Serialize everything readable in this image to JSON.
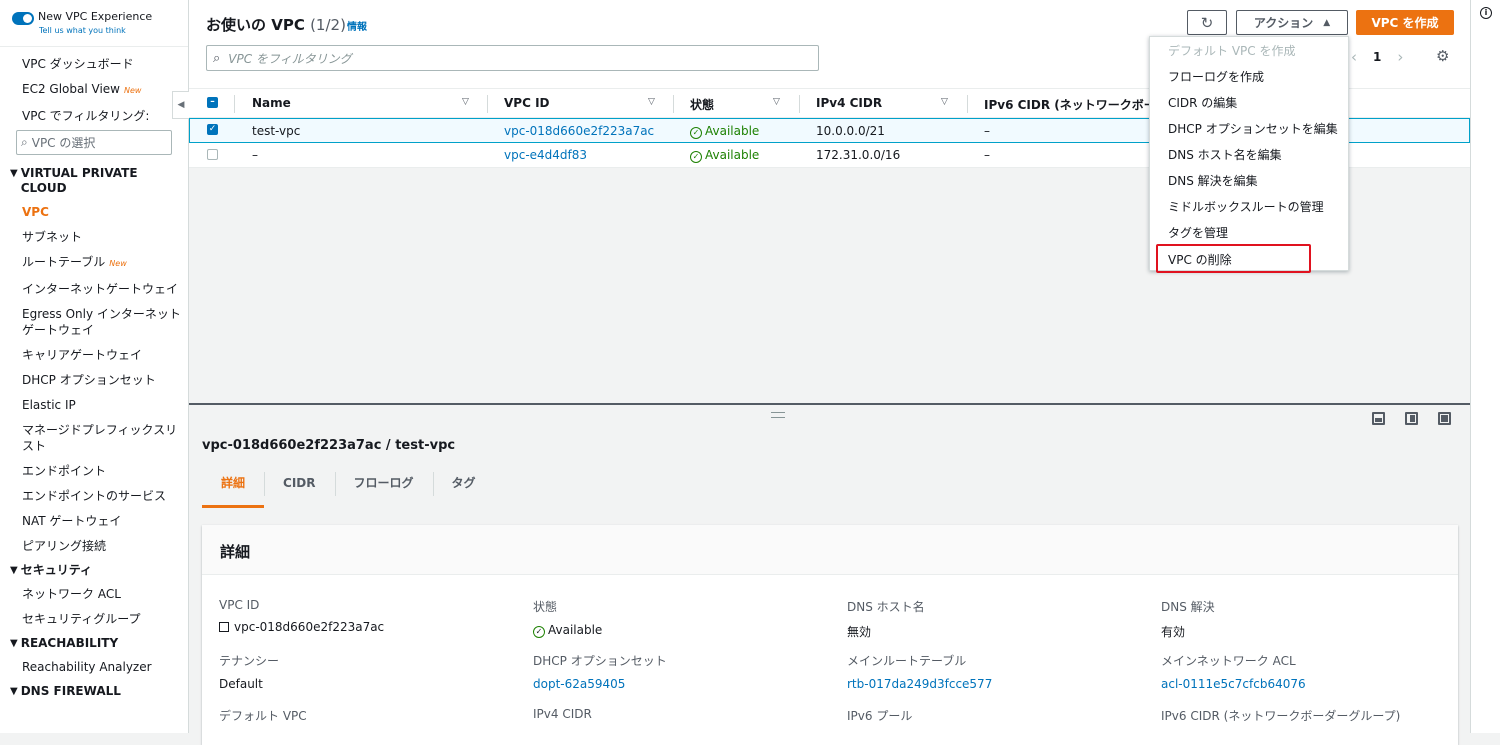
{
  "sidebar": {
    "experience_toggle": "New VPC Experience",
    "experience_sub": "Tell us what you think",
    "dashboard": "VPC ダッシュボード",
    "global_view": "EC2 Global View",
    "new_badge": "New",
    "filter_label": "VPC でフィルタリング:",
    "filter_placeholder": "VPC の選択",
    "section_vpc": "VIRTUAL PRIVATE CLOUD",
    "vpc": "VPC",
    "subnets": "サブネット",
    "route_tables": "ルートテーブル",
    "igw": "インターネットゲートウェイ",
    "egress_igw": "Egress Only インターネットゲートウェイ",
    "carrier_gw": "キャリアゲートウェイ",
    "dhcp": "DHCP オプションセット",
    "elastic_ip": "Elastic IP",
    "prefix_list": "マネージドプレフィックスリスト",
    "endpoints": "エンドポイント",
    "endpoint_services": "エンドポイントのサービス",
    "nat_gw": "NAT ゲートウェイ",
    "peering": "ピアリング接続",
    "section_security": "セキュリティ",
    "nacl": "ネットワーク ACL",
    "security_groups": "セキュリティグループ",
    "section_reachability": "REACHABILITY",
    "reachability_analyzer": "Reachability Analyzer",
    "section_dns": "DNS FIREWALL"
  },
  "header": {
    "title": "お使いの VPC",
    "count": "(1/2)",
    "info": "情報",
    "actions": "アクション",
    "create": "VPC を作成",
    "search_placeholder": "VPC をフィルタリング",
    "page": "1"
  },
  "table": {
    "headers": [
      "Name",
      "VPC ID",
      "状態",
      "IPv4 CIDR",
      "IPv6 CIDR (ネットワークボーダ"
    ],
    "rows": [
      {
        "name": "test-vpc",
        "id": "vpc-018d660e2f223a7ac",
        "state": "Available",
        "ipv4": "10.0.0.0/21",
        "ipv6": "–"
      },
      {
        "name": "–",
        "id": "vpc-e4d4df83",
        "state": "Available",
        "ipv4": "172.31.0.0/16",
        "ipv6": "–"
      }
    ]
  },
  "dropdown": {
    "items": [
      "デフォルト VPC を作成",
      "フローログを作成",
      "CIDR の編集",
      "DHCP オプションセットを編集",
      "DNS ホスト名を編集",
      "DNS 解決を編集",
      "ミドルボックスルートの管理",
      "タグを管理",
      "VPC の削除"
    ]
  },
  "details": {
    "title": "vpc-018d660e2f223a7ac / test-vpc",
    "tabs": [
      "詳細",
      "CIDR",
      "フローログ",
      "タグ"
    ],
    "card_title": "詳細",
    "vpc_id_label": "VPC ID",
    "vpc_id": "vpc-018d660e2f223a7ac",
    "state_label": "状態",
    "state": "Available",
    "dns_host_label": "DNS ホスト名",
    "dns_host": "無効",
    "dns_res_label": "DNS 解決",
    "dns_res": "有効",
    "tenancy_label": "テナンシー",
    "tenancy": "Default",
    "dhcp_label": "DHCP オプションセット",
    "dhcp": "dopt-62a59405",
    "main_rt_label": "メインルートテーブル",
    "main_rt": "rtb-017da249d3fcce577",
    "main_acl_label": "メインネットワーク ACL",
    "main_acl": "acl-0111e5c7cfcb64076",
    "default_vpc_label": "デフォルト VPC",
    "ipv4_label": "IPv4 CIDR",
    "ipv6_pool_label": "IPv6 プール",
    "ipv6_cidr_label": "IPv6 CIDR (ネットワークボーダーグループ)"
  },
  "colors": {
    "accent": "#ec7211",
    "link": "#0073bb",
    "success": "#1d8102",
    "highlight": "#e0121f"
  }
}
